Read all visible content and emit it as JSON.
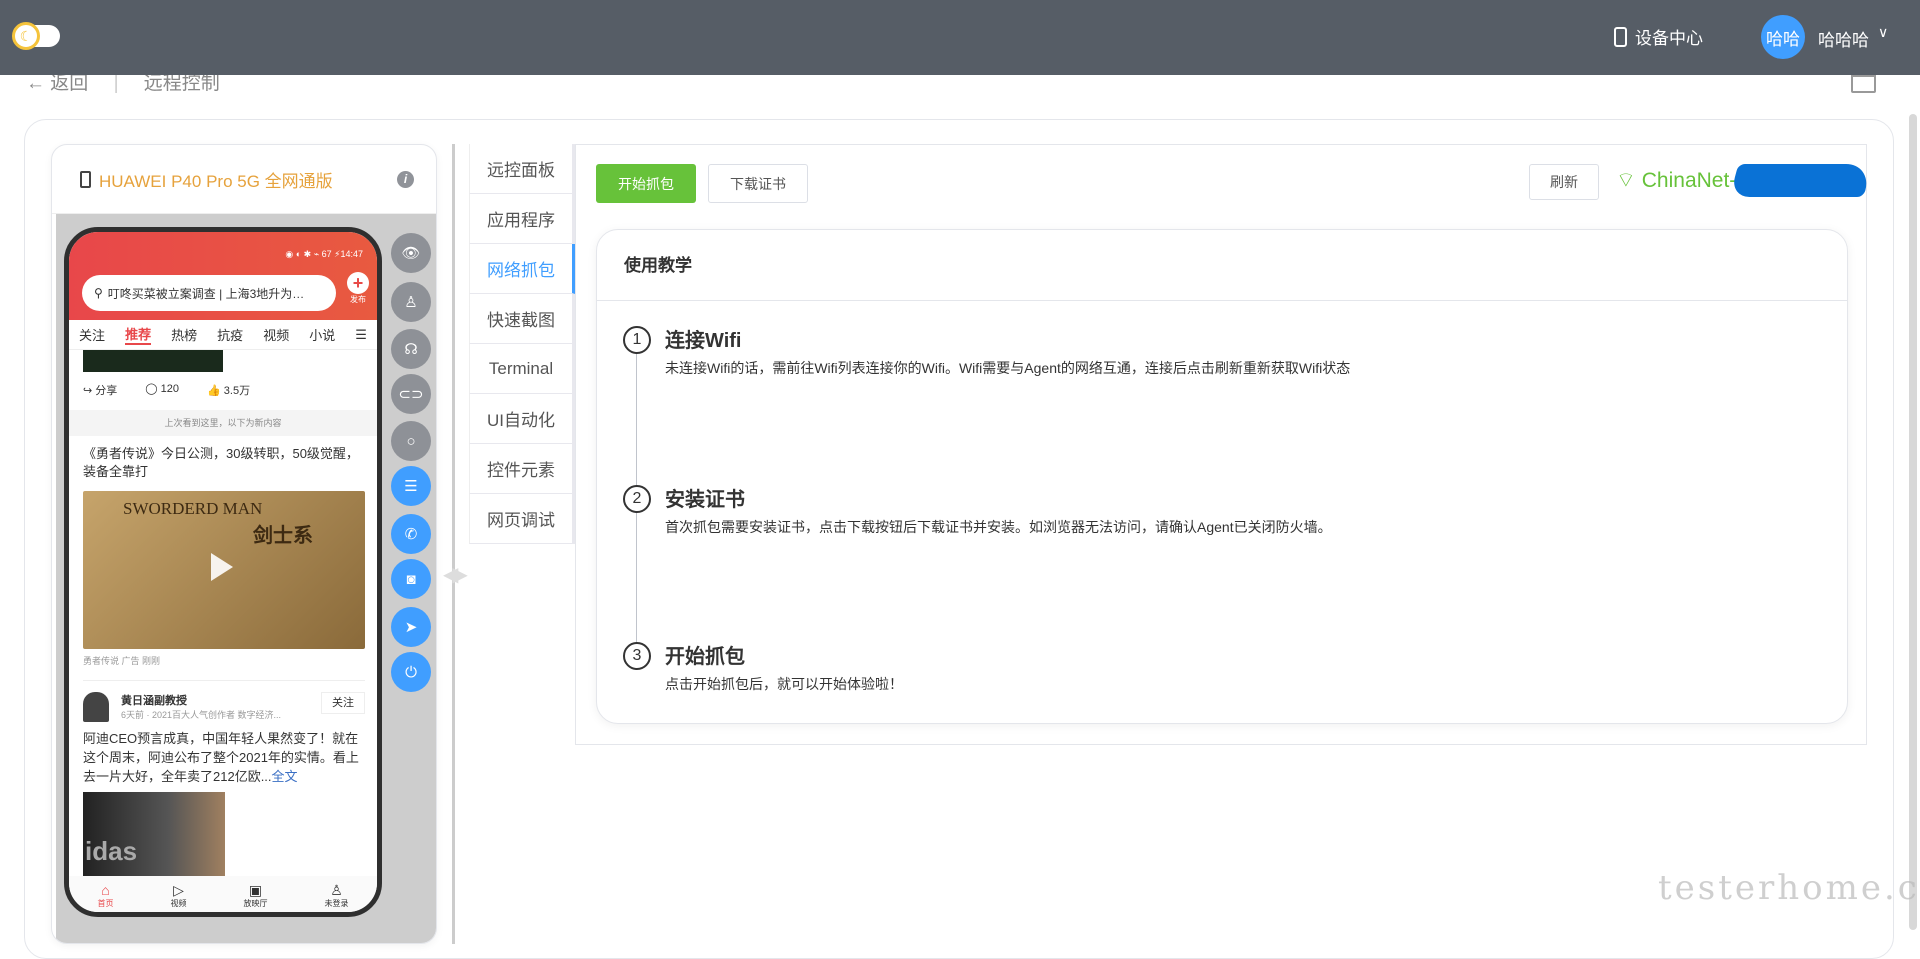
{
  "topbar": {
    "device_center": "设备中心",
    "avatar_text": "哈哈",
    "username": "哈哈哈"
  },
  "breadcrumb": {
    "back": "← 返回",
    "sep": "|",
    "current": "远程控制"
  },
  "device": {
    "name": "HUAWEI P40 Pro 5G 全网通版",
    "info": "i"
  },
  "phone": {
    "status": "◉ ◐ ✱ ⌁ 67 ⚡14:47",
    "search": "叮咚买菜被立案调查 | 上海3地升为…",
    "publish": "发布",
    "tabs": [
      "关注",
      "推荐",
      "热榜",
      "抗疫",
      "视频",
      "小说",
      "☰"
    ],
    "actions": {
      "share": "分享",
      "comments": "120",
      "likes": "3.5万"
    },
    "band": "上次看到这里，以下为新内容",
    "article_title": "《勇者传说》今日公测，30级转职，50级觉醒，装备全靠打",
    "game_name": "SWORDERD MAN",
    "game_sub": "剑士系",
    "ad_line": "勇者传说  广告  刚刚",
    "author": {
      "name": "黄日涵副教授",
      "sub": "6天前 · 2021百大人气创作者 数字经济...",
      "follow": "关注"
    },
    "body": "阿迪CEO预言成真，中国年轻人果然变了！就在这个周末，阿迪公布了整个2021年的实情。看上去一片大好，全年卖了212亿欧...",
    "body_more": "全文",
    "img_text": "idas",
    "nav": [
      {
        "icon": "⌂",
        "label": "首页"
      },
      {
        "icon": "▷",
        "label": "视频"
      },
      {
        "icon": "▣",
        "label": "放映厅"
      },
      {
        "icon": "♙",
        "label": "未登录"
      }
    ]
  },
  "control_buttons": [
    {
      "icon": "eye",
      "glyph": "👁",
      "color": "#8e9197"
    },
    {
      "icon": "user",
      "glyph": "♙",
      "color": "#8e9197"
    },
    {
      "icon": "headset",
      "glyph": "☊",
      "color": "#8e9197"
    },
    {
      "icon": "link",
      "glyph": "⊂⊃",
      "color": "#8e9197"
    },
    {
      "icon": "search",
      "glyph": "○",
      "color": "#8e9197"
    },
    {
      "icon": "sliders",
      "glyph": "☰",
      "color": "#409eff"
    },
    {
      "icon": "phone",
      "glyph": "✆",
      "color": "#409eff"
    },
    {
      "icon": "camera",
      "glyph": "◙",
      "color": "#409eff"
    },
    {
      "icon": "location",
      "glyph": "➤",
      "color": "#409eff"
    },
    {
      "icon": "power",
      "glyph": "⏻",
      "color": "#409eff"
    }
  ],
  "tabs": [
    "远控面板",
    "应用程序",
    "网络抓包",
    "快速截图",
    "Terminal",
    "UI自动化",
    "控件元素",
    "网页调试"
  ],
  "active_tab": 2,
  "toolbar": {
    "start": "开始抓包",
    "download_cert": "下载证书",
    "refresh": "刷新",
    "wifi": "ChinaNet-7"
  },
  "colors": {
    "green": "#67c23a",
    "blue": "#409eff",
    "header": "#565d66"
  },
  "tutorial": {
    "title": "使用教学",
    "steps": [
      {
        "num": "1",
        "title": "连接Wifi",
        "desc": "未连接Wifi的话，需前往Wifi列表连接你的Wifi。Wifi需要与Agent的网络互通，连接后点击刷新重新获取Wifi状态"
      },
      {
        "num": "2",
        "title": "安装证书",
        "desc": "首次抓包需要安装证书，点击下载按钮后下载证书并安装。如浏览器无法访问，请确认Agent已关闭防火墙。"
      },
      {
        "num": "3",
        "title": "开始抓包",
        "desc": "点击开始抓包后，就可以开始体验啦！"
      }
    ]
  },
  "watermark": "testerhome.com"
}
